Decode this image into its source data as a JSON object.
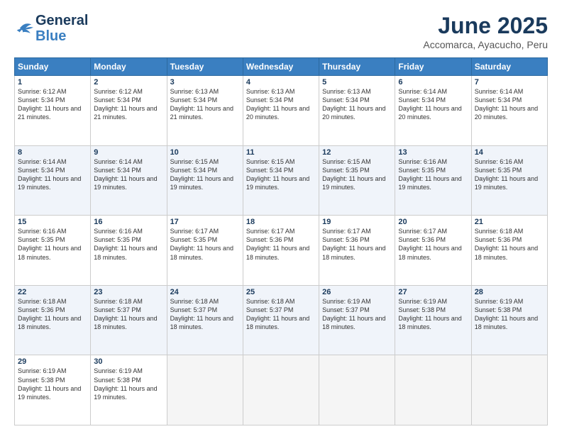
{
  "header": {
    "logo_general": "General",
    "logo_blue": "Blue",
    "month_title": "June 2025",
    "location": "Accomarca, Ayacucho, Peru"
  },
  "weekdays": [
    "Sunday",
    "Monday",
    "Tuesday",
    "Wednesday",
    "Thursday",
    "Friday",
    "Saturday"
  ],
  "weeks": [
    [
      {
        "day": "1",
        "sunrise": "Sunrise: 6:12 AM",
        "sunset": "Sunset: 5:34 PM",
        "daylight": "Daylight: 11 hours and 21 minutes."
      },
      {
        "day": "2",
        "sunrise": "Sunrise: 6:12 AM",
        "sunset": "Sunset: 5:34 PM",
        "daylight": "Daylight: 11 hours and 21 minutes."
      },
      {
        "day": "3",
        "sunrise": "Sunrise: 6:13 AM",
        "sunset": "Sunset: 5:34 PM",
        "daylight": "Daylight: 11 hours and 21 minutes."
      },
      {
        "day": "4",
        "sunrise": "Sunrise: 6:13 AM",
        "sunset": "Sunset: 5:34 PM",
        "daylight": "Daylight: 11 hours and 20 minutes."
      },
      {
        "day": "5",
        "sunrise": "Sunrise: 6:13 AM",
        "sunset": "Sunset: 5:34 PM",
        "daylight": "Daylight: 11 hours and 20 minutes."
      },
      {
        "day": "6",
        "sunrise": "Sunrise: 6:14 AM",
        "sunset": "Sunset: 5:34 PM",
        "daylight": "Daylight: 11 hours and 20 minutes."
      },
      {
        "day": "7",
        "sunrise": "Sunrise: 6:14 AM",
        "sunset": "Sunset: 5:34 PM",
        "daylight": "Daylight: 11 hours and 20 minutes."
      }
    ],
    [
      {
        "day": "8",
        "sunrise": "Sunrise: 6:14 AM",
        "sunset": "Sunset: 5:34 PM",
        "daylight": "Daylight: 11 hours and 19 minutes."
      },
      {
        "day": "9",
        "sunrise": "Sunrise: 6:14 AM",
        "sunset": "Sunset: 5:34 PM",
        "daylight": "Daylight: 11 hours and 19 minutes."
      },
      {
        "day": "10",
        "sunrise": "Sunrise: 6:15 AM",
        "sunset": "Sunset: 5:34 PM",
        "daylight": "Daylight: 11 hours and 19 minutes."
      },
      {
        "day": "11",
        "sunrise": "Sunrise: 6:15 AM",
        "sunset": "Sunset: 5:34 PM",
        "daylight": "Daylight: 11 hours and 19 minutes."
      },
      {
        "day": "12",
        "sunrise": "Sunrise: 6:15 AM",
        "sunset": "Sunset: 5:35 PM",
        "daylight": "Daylight: 11 hours and 19 minutes."
      },
      {
        "day": "13",
        "sunrise": "Sunrise: 6:16 AM",
        "sunset": "Sunset: 5:35 PM",
        "daylight": "Daylight: 11 hours and 19 minutes."
      },
      {
        "day": "14",
        "sunrise": "Sunrise: 6:16 AM",
        "sunset": "Sunset: 5:35 PM",
        "daylight": "Daylight: 11 hours and 19 minutes."
      }
    ],
    [
      {
        "day": "15",
        "sunrise": "Sunrise: 6:16 AM",
        "sunset": "Sunset: 5:35 PM",
        "daylight": "Daylight: 11 hours and 18 minutes."
      },
      {
        "day": "16",
        "sunrise": "Sunrise: 6:16 AM",
        "sunset": "Sunset: 5:35 PM",
        "daylight": "Daylight: 11 hours and 18 minutes."
      },
      {
        "day": "17",
        "sunrise": "Sunrise: 6:17 AM",
        "sunset": "Sunset: 5:35 PM",
        "daylight": "Daylight: 11 hours and 18 minutes."
      },
      {
        "day": "18",
        "sunrise": "Sunrise: 6:17 AM",
        "sunset": "Sunset: 5:36 PM",
        "daylight": "Daylight: 11 hours and 18 minutes."
      },
      {
        "day": "19",
        "sunrise": "Sunrise: 6:17 AM",
        "sunset": "Sunset: 5:36 PM",
        "daylight": "Daylight: 11 hours and 18 minutes."
      },
      {
        "day": "20",
        "sunrise": "Sunrise: 6:17 AM",
        "sunset": "Sunset: 5:36 PM",
        "daylight": "Daylight: 11 hours and 18 minutes."
      },
      {
        "day": "21",
        "sunrise": "Sunrise: 6:18 AM",
        "sunset": "Sunset: 5:36 PM",
        "daylight": "Daylight: 11 hours and 18 minutes."
      }
    ],
    [
      {
        "day": "22",
        "sunrise": "Sunrise: 6:18 AM",
        "sunset": "Sunset: 5:36 PM",
        "daylight": "Daylight: 11 hours and 18 minutes."
      },
      {
        "day": "23",
        "sunrise": "Sunrise: 6:18 AM",
        "sunset": "Sunset: 5:37 PM",
        "daylight": "Daylight: 11 hours and 18 minutes."
      },
      {
        "day": "24",
        "sunrise": "Sunrise: 6:18 AM",
        "sunset": "Sunset: 5:37 PM",
        "daylight": "Daylight: 11 hours and 18 minutes."
      },
      {
        "day": "25",
        "sunrise": "Sunrise: 6:18 AM",
        "sunset": "Sunset: 5:37 PM",
        "daylight": "Daylight: 11 hours and 18 minutes."
      },
      {
        "day": "26",
        "sunrise": "Sunrise: 6:19 AM",
        "sunset": "Sunset: 5:37 PM",
        "daylight": "Daylight: 11 hours and 18 minutes."
      },
      {
        "day": "27",
        "sunrise": "Sunrise: 6:19 AM",
        "sunset": "Sunset: 5:38 PM",
        "daylight": "Daylight: 11 hours and 18 minutes."
      },
      {
        "day": "28",
        "sunrise": "Sunrise: 6:19 AM",
        "sunset": "Sunset: 5:38 PM",
        "daylight": "Daylight: 11 hours and 18 minutes."
      }
    ],
    [
      {
        "day": "29",
        "sunrise": "Sunrise: 6:19 AM",
        "sunset": "Sunset: 5:38 PM",
        "daylight": "Daylight: 11 hours and 19 minutes."
      },
      {
        "day": "30",
        "sunrise": "Sunrise: 6:19 AM",
        "sunset": "Sunset: 5:38 PM",
        "daylight": "Daylight: 11 hours and 19 minutes."
      },
      null,
      null,
      null,
      null,
      null
    ]
  ]
}
